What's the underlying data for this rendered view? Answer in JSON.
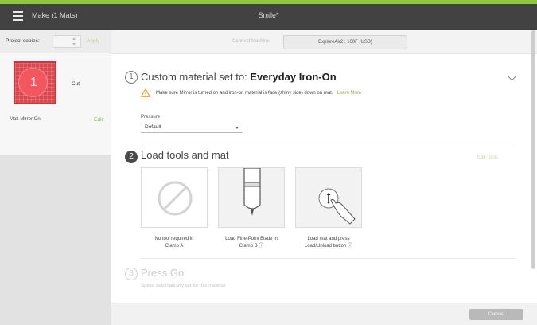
{
  "header": {
    "menu_icon": "hamburger-icon",
    "make_title": "Make (1 Mats)",
    "project_title": "Smile*"
  },
  "sidebar": {
    "copies_label": "Project copies:",
    "copies_value": "",
    "apply_label": "Apply",
    "mat": {
      "number": "1",
      "action": "Cut",
      "status": "Mat: Mirror On",
      "edit_label": "Edit"
    }
  },
  "connect": {
    "label": "Connect Machine",
    "machine": "ExploreAir2 : 100F (USB)"
  },
  "step1": {
    "number": "1",
    "title_prefix": "Custom material set to: ",
    "material": "Everyday Iron-On",
    "warning": "Make sure Mirror is turned on and iron-on material is face (shiny side) down on mat.",
    "learn_more": "Learn More",
    "pressure_label": "Pressure",
    "pressure_value": "Default"
  },
  "step2": {
    "number": "2",
    "title": "Load tools and mat",
    "edit_tools": "Edit Tools",
    "cards": [
      {
        "icon": "no-tool-icon",
        "line1": "No tool required in",
        "line2": "Clamp A"
      },
      {
        "icon": "fine-point-blade-icon",
        "line1": "Load Fine-Point Blade in",
        "line2": "Clamp B ⓘ"
      },
      {
        "icon": "load-button-icon",
        "line1": "Load mat and press",
        "line2": "Load/Unload button ⓘ"
      }
    ]
  },
  "step3": {
    "number": "3",
    "title": "Press Go",
    "subtitle": "Speed automatically set for this material"
  },
  "footer": {
    "cancel_label": "Cancel"
  },
  "colors": {
    "accent_green": "#8dc63f",
    "mat_red": "#d9484f",
    "titlebar": "#424242"
  }
}
